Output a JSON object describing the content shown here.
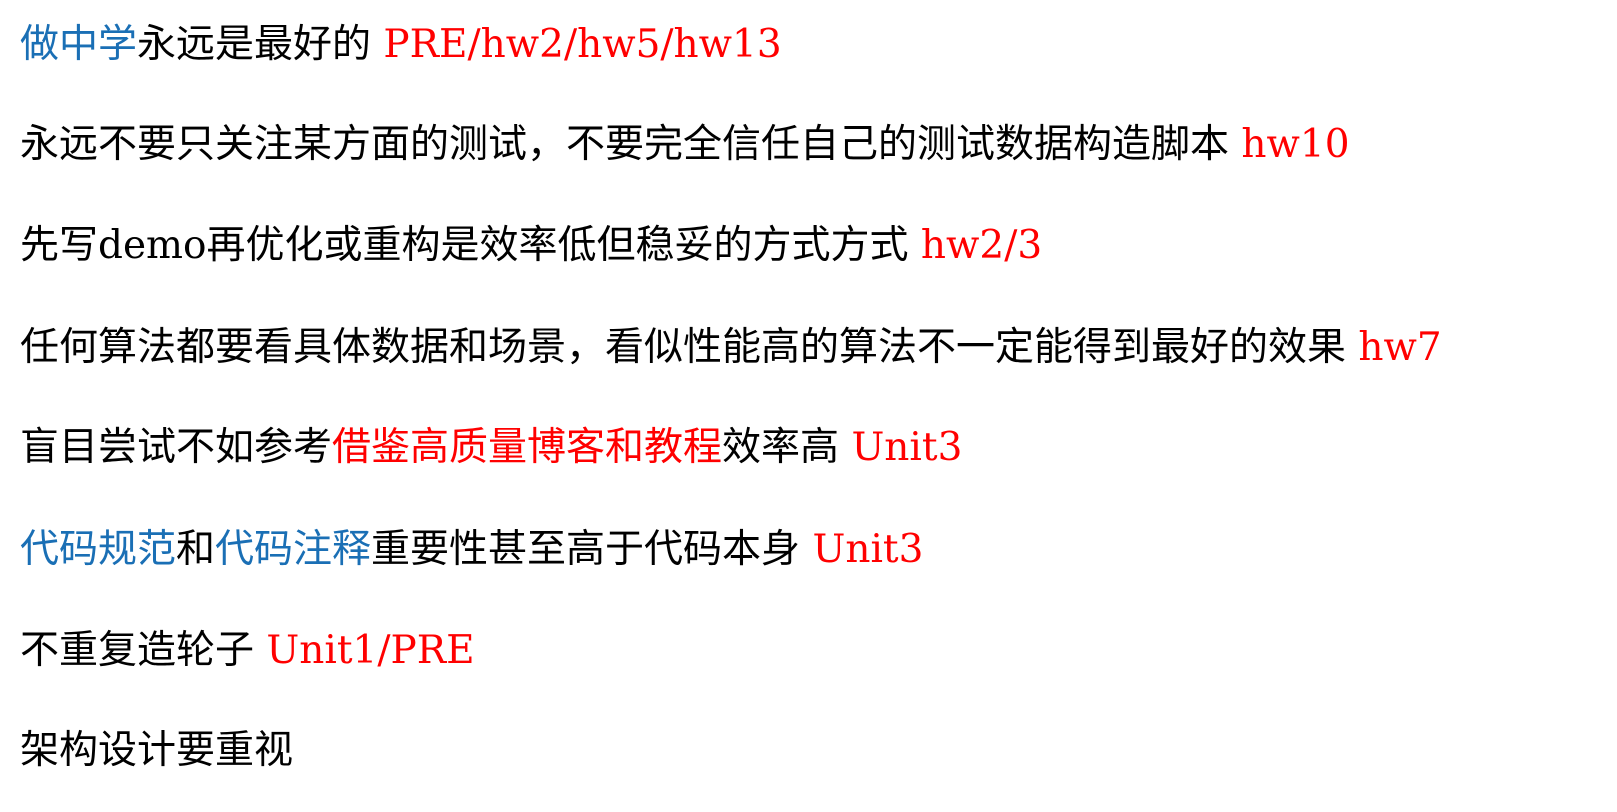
{
  "colors": {
    "text": "#000000",
    "highlight_blue": "#1a6fb5",
    "reference_red": "#ff0000",
    "background": "#ffffff"
  },
  "lines": [
    {
      "segments": [
        {
          "text": "做中学",
          "color": "blue"
        },
        {
          "text": "永远是最好的 ",
          "color": "black"
        },
        {
          "text": "PRE/hw2/hw5/hw13",
          "color": "red"
        }
      ]
    },
    {
      "segments": [
        {
          "text": "永远不要只关注某方面的测试，不要完全信任自己的测试数据构造脚本 ",
          "color": "black"
        },
        {
          "text": "hw10",
          "color": "red"
        }
      ]
    },
    {
      "segments": [
        {
          "text": "先写demo再优化或重构是效率低但稳妥的方式方式 ",
          "color": "black"
        },
        {
          "text": "hw2/3",
          "color": "red"
        }
      ]
    },
    {
      "segments": [
        {
          "text": "任何算法都要看具体数据和场景，看似性能高的算法不一定能得到最好的效果 ",
          "color": "black"
        },
        {
          "text": "hw7",
          "color": "red"
        }
      ]
    },
    {
      "segments": [
        {
          "text": "盲目尝试不如参考",
          "color": "black"
        },
        {
          "text": "借鉴高质量博客和教程",
          "color": "red"
        },
        {
          "text": "效率高 ",
          "color": "black"
        },
        {
          "text": "Unit3",
          "color": "red"
        }
      ]
    },
    {
      "segments": [
        {
          "text": "代码规范",
          "color": "blue"
        },
        {
          "text": "和",
          "color": "black"
        },
        {
          "text": "代码注释",
          "color": "blue"
        },
        {
          "text": "重要性甚至高于代码本身 ",
          "color": "black"
        },
        {
          "text": "Unit3",
          "color": "red"
        }
      ]
    },
    {
      "segments": [
        {
          "text": "不重复造轮子 ",
          "color": "black"
        },
        {
          "text": "Unit1/PRE",
          "color": "red"
        }
      ]
    },
    {
      "segments": [
        {
          "text": "架构设计要重视",
          "color": "black"
        }
      ]
    }
  ]
}
